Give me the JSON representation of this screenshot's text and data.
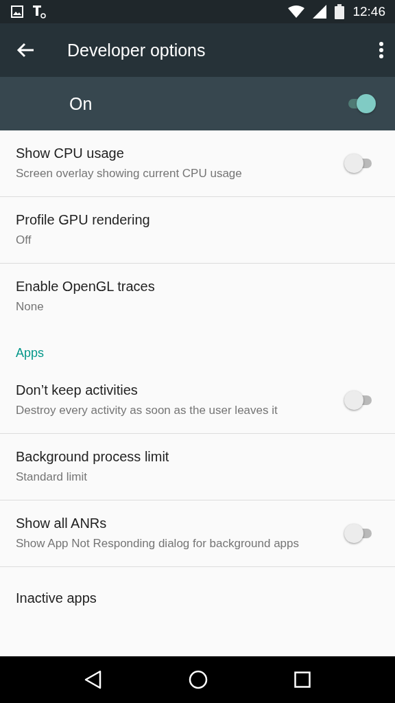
{
  "status_bar": {
    "time": "12:46"
  },
  "app_bar": {
    "title": "Developer options"
  },
  "master_switch": {
    "label": "On",
    "on": true
  },
  "sections": [
    {
      "items": [
        {
          "kind": "switch",
          "title": "Show CPU usage",
          "summary": "Screen overlay showing current CPU usage",
          "on": false
        },
        {
          "kind": "plain",
          "title": "Profile GPU rendering",
          "summary": "Off"
        },
        {
          "kind": "plain",
          "title": "Enable OpenGL traces",
          "summary": "None"
        }
      ]
    },
    {
      "header": "Apps",
      "items": [
        {
          "kind": "switch",
          "title": "Don’t keep activities",
          "summary": "Destroy every activity as soon as the user leaves it",
          "on": false
        },
        {
          "kind": "plain",
          "title": "Background process limit",
          "summary": "Standard limit"
        },
        {
          "kind": "switch",
          "title": "Show all ANRs",
          "summary": "Show App Not Responding dialog for background apps",
          "on": false
        },
        {
          "kind": "plain",
          "title": "Inactive apps"
        }
      ]
    }
  ]
}
